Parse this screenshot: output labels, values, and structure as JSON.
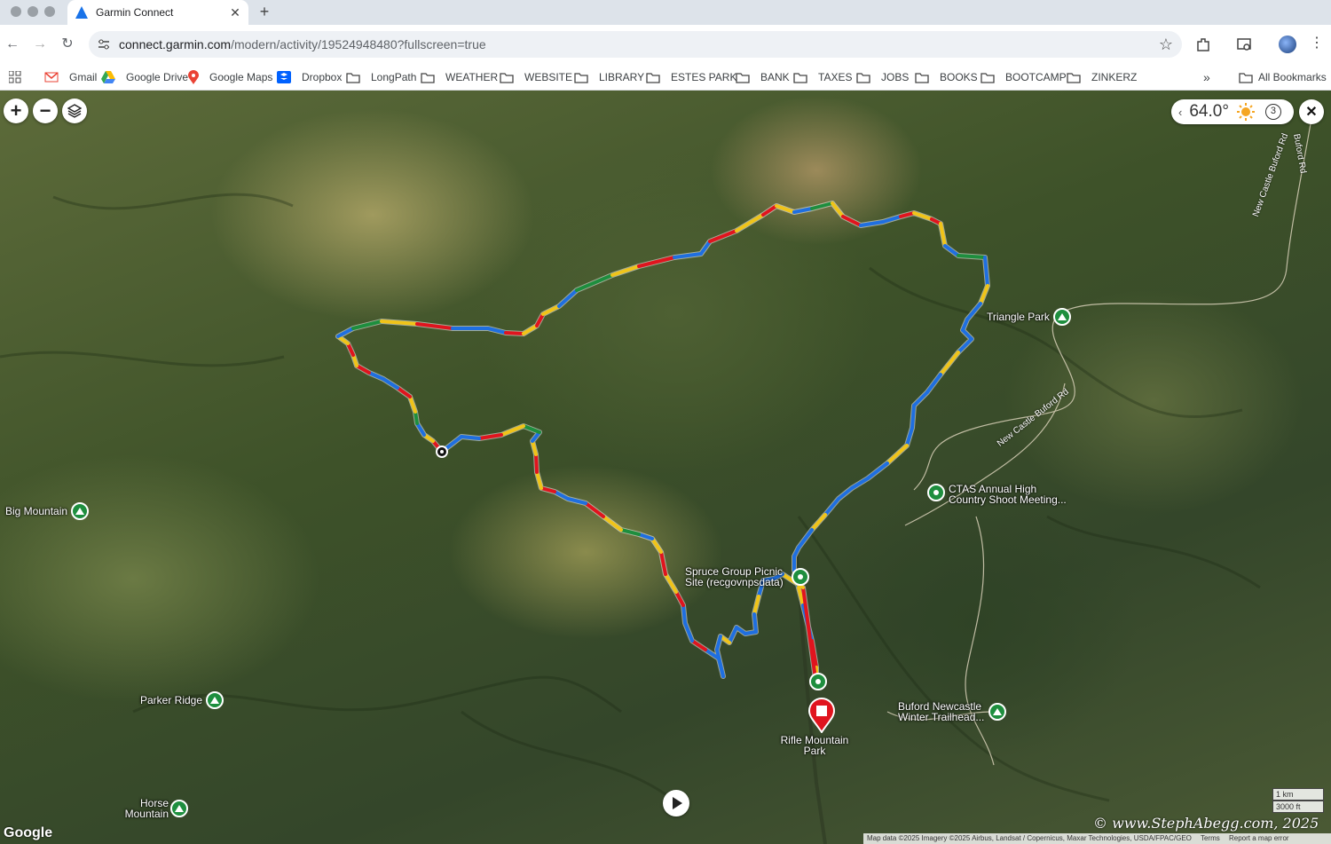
{
  "browser": {
    "tab": {
      "title": "Garmin Connect",
      "favicon": "garmin-triangle-icon"
    },
    "url": {
      "host": "connect.garmin.com",
      "path": "/modern/activity/19524948480?fullscreen=true"
    },
    "bookmarks": [
      {
        "label": "Gmail",
        "icon": "gmail-icon"
      },
      {
        "label": "Google Drive",
        "icon": "google-drive-icon"
      },
      {
        "label": "Google Maps",
        "icon": "google-maps-icon"
      },
      {
        "label": "Dropbox",
        "icon": "dropbox-icon"
      },
      {
        "label": "LongPath",
        "icon": "folder-icon"
      },
      {
        "label": "WEATHER",
        "icon": "folder-icon"
      },
      {
        "label": "WEBSITE",
        "icon": "folder-icon"
      },
      {
        "label": "LIBRARY",
        "icon": "folder-icon"
      },
      {
        "label": "ESTES PARK",
        "icon": "folder-icon"
      },
      {
        "label": "BANK",
        "icon": "folder-icon"
      },
      {
        "label": "TAXES",
        "icon": "folder-icon"
      },
      {
        "label": "JOBS",
        "icon": "folder-icon"
      },
      {
        "label": "BOOKS",
        "icon": "folder-icon"
      },
      {
        "label": "BOOTCAMP",
        "icon": "folder-icon"
      },
      {
        "label": "ZINKERZ",
        "icon": "folder-icon"
      }
    ],
    "overflow": "»",
    "all_bookmarks": "All Bookmarks"
  },
  "map": {
    "weather": {
      "temperature": "64.0°",
      "condition_icon": "sun-icon",
      "wind": "3"
    },
    "controls": {
      "zoom_in": "+",
      "zoom_out": "−",
      "layers_icon": "layers-icon",
      "close": "✕"
    },
    "pois": [
      {
        "label": "Big Mountain",
        "type": "peak"
      },
      {
        "label": "Triangle Park",
        "type": "park"
      },
      {
        "label": "CTAS Annual High Country Shoot Meeting...",
        "type": "place"
      },
      {
        "label": "Spruce Group Picnic Site (recgovnpsdata)",
        "type": "picnic"
      },
      {
        "label": "Parker Ridge",
        "type": "peak"
      },
      {
        "label": "Rifle Mountain Park",
        "type": "end"
      },
      {
        "label": "Buford Newcastle Winter Trailhead...",
        "type": "trailhead"
      },
      {
        "label": "Horse Mountain",
        "type": "peak"
      }
    ],
    "roads": [
      "New Castle Buford Rd",
      "New Castle Buford Rd",
      "Buford Rd"
    ],
    "scale": {
      "metric": "1 km",
      "imperial": "3000 ft"
    },
    "google_logo": "Google",
    "watermark": "© www.StephAbegg.com, 2025",
    "attribution": {
      "data": "Map data ©2025 Imagery ©2025 Airbus, Landsat / Copernicus, Maxar Technologies, USDA/FPAC/GEO",
      "terms": "Terms",
      "report": "Report a map error"
    },
    "colors": {
      "fast": "#1f6fe0",
      "mid": "#f0c419",
      "slow": "#e0141e",
      "green": "#1e8e3e"
    }
  }
}
